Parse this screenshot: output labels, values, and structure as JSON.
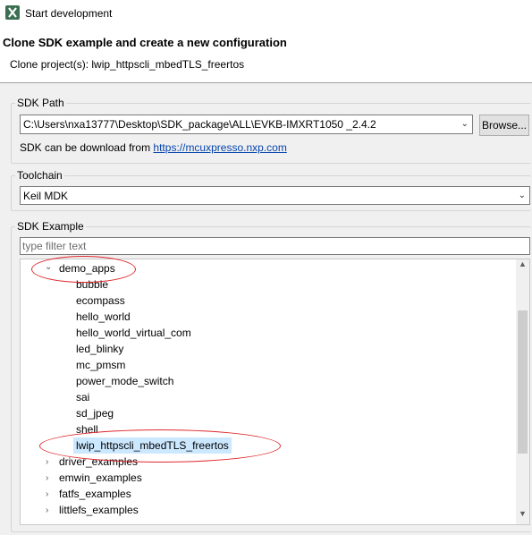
{
  "window": {
    "title": "Start development"
  },
  "header": {
    "title": "Clone SDK example and create a new configuration",
    "message": "Clone project(s): lwip_httpscli_mbedTLS_freertos"
  },
  "sdk_path": {
    "legend": "SDK Path",
    "value": "C:\\Users\\nxa13777\\Desktop\\SDK_package\\ALL\\EVKB-IMXRT1050 _2.4.2",
    "browse_label": "Browse...",
    "download_prefix": "SDK can be download from ",
    "download_link": "https://mcuxpresso.nxp.com"
  },
  "toolchain": {
    "legend": "Toolchain",
    "value": "Keil MDK"
  },
  "sdk_example": {
    "legend": "SDK Example",
    "filter_placeholder": "type filter text",
    "tree": {
      "expanded": {
        "label": "demo_apps",
        "children": [
          "bubble",
          "ecompass",
          "hello_world",
          "hello_world_virtual_com",
          "led_blinky",
          "mc_pmsm",
          "power_mode_switch",
          "sai",
          "sd_jpeg",
          "shell",
          "lwip_httpscli_mbedTLS_freertos"
        ],
        "selected": "lwip_httpscli_mbedTLS_freertos"
      },
      "collapsed": [
        "driver_examples",
        "emwin_examples",
        "fatfs_examples",
        "littlefs_examples"
      ]
    }
  },
  "colors": {
    "selection": "#cce8ff",
    "annotation": "#e0282b",
    "link": "#0645ad"
  }
}
